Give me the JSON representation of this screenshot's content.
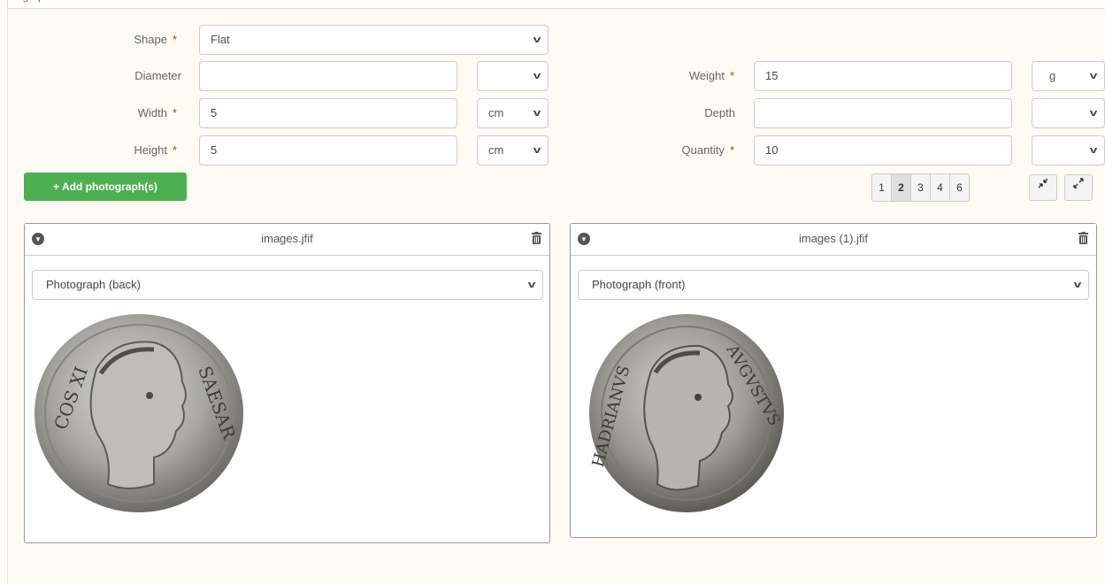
{
  "top_label": "ograph",
  "form": {
    "shape": {
      "label": "Shape",
      "value": "Flat"
    },
    "diameter": {
      "label": "Diameter",
      "value": "",
      "unit": ""
    },
    "width": {
      "label": "Width",
      "value": "5",
      "unit": "cm"
    },
    "height": {
      "label": "Height",
      "value": "5",
      "unit": "cm"
    },
    "weight": {
      "label": "Weight",
      "value": "15",
      "unit": "g"
    },
    "depth": {
      "label": "Depth",
      "value": "",
      "unit": ""
    },
    "quantity": {
      "label": "Quantity",
      "value": "10",
      "unit": ""
    },
    "required_mark": "*"
  },
  "add_button": {
    "icon": "+",
    "label": "Add photograph(s)"
  },
  "pager": {
    "pages": [
      "1",
      "2",
      "3",
      "4",
      "6"
    ],
    "active": "2"
  },
  "zoom_buttons": {
    "shrink": "shrink-icon",
    "expand": "expand-icon"
  },
  "photos": [
    {
      "filename": "images.jfif",
      "type": "Photograph (back)"
    },
    {
      "filename": "images (1).jfif",
      "type": "Photograph (front)"
    }
  ],
  "colors": {
    "add_button": "#4cb050",
    "required": "#c9302c",
    "background": "#fdfbf4"
  }
}
